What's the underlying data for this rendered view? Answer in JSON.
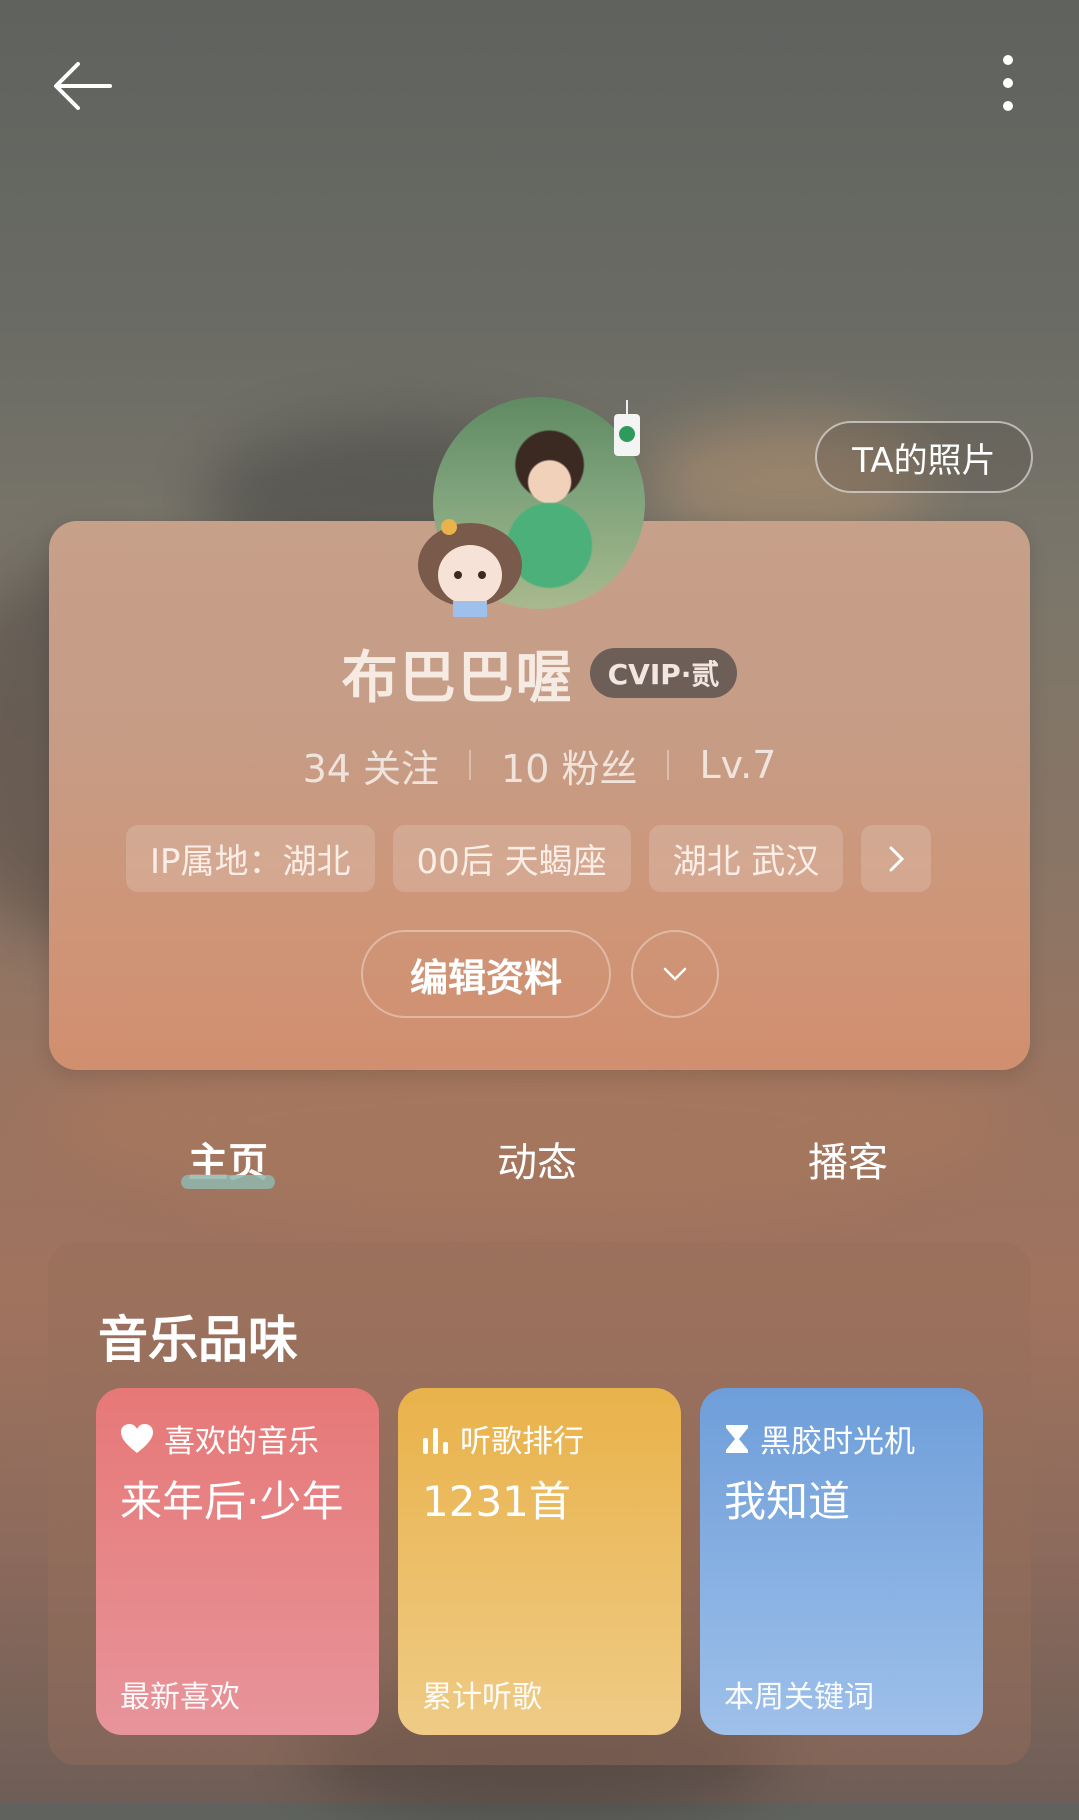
{
  "header": {
    "back_icon": "arrow-left-icon",
    "more_icon": "more-vertical-icon"
  },
  "photos_button": "TA的照片",
  "profile": {
    "name": "布巴巴喔",
    "vip_badge": "CVIP·贰",
    "follow": "34 关注",
    "fans": "10 粉丝",
    "level": "Lv.7",
    "tags": [
      "IP属地：湖北",
      "00后 天蝎座",
      "湖北 武汉"
    ],
    "edit_button": "编辑资料"
  },
  "tabs": [
    "主页",
    "动态",
    "播客"
  ],
  "active_tab": "主页",
  "music_taste": {
    "title": "音乐品味",
    "tiles": [
      {
        "icon": "heart-icon",
        "label": "喜欢的音乐",
        "value": "来年后·少年",
        "footer": "最新喜欢",
        "color": "#e77877"
      },
      {
        "icon": "bar-chart-icon",
        "label": "听歌排行",
        "value": "1231首",
        "footer": "累计听歌",
        "color": "#e9b24a"
      },
      {
        "icon": "hourglass-icon",
        "label": "黑胶时光机",
        "value": "我知道",
        "footer": "本周关键词",
        "color": "#6e9ed9"
      }
    ]
  }
}
